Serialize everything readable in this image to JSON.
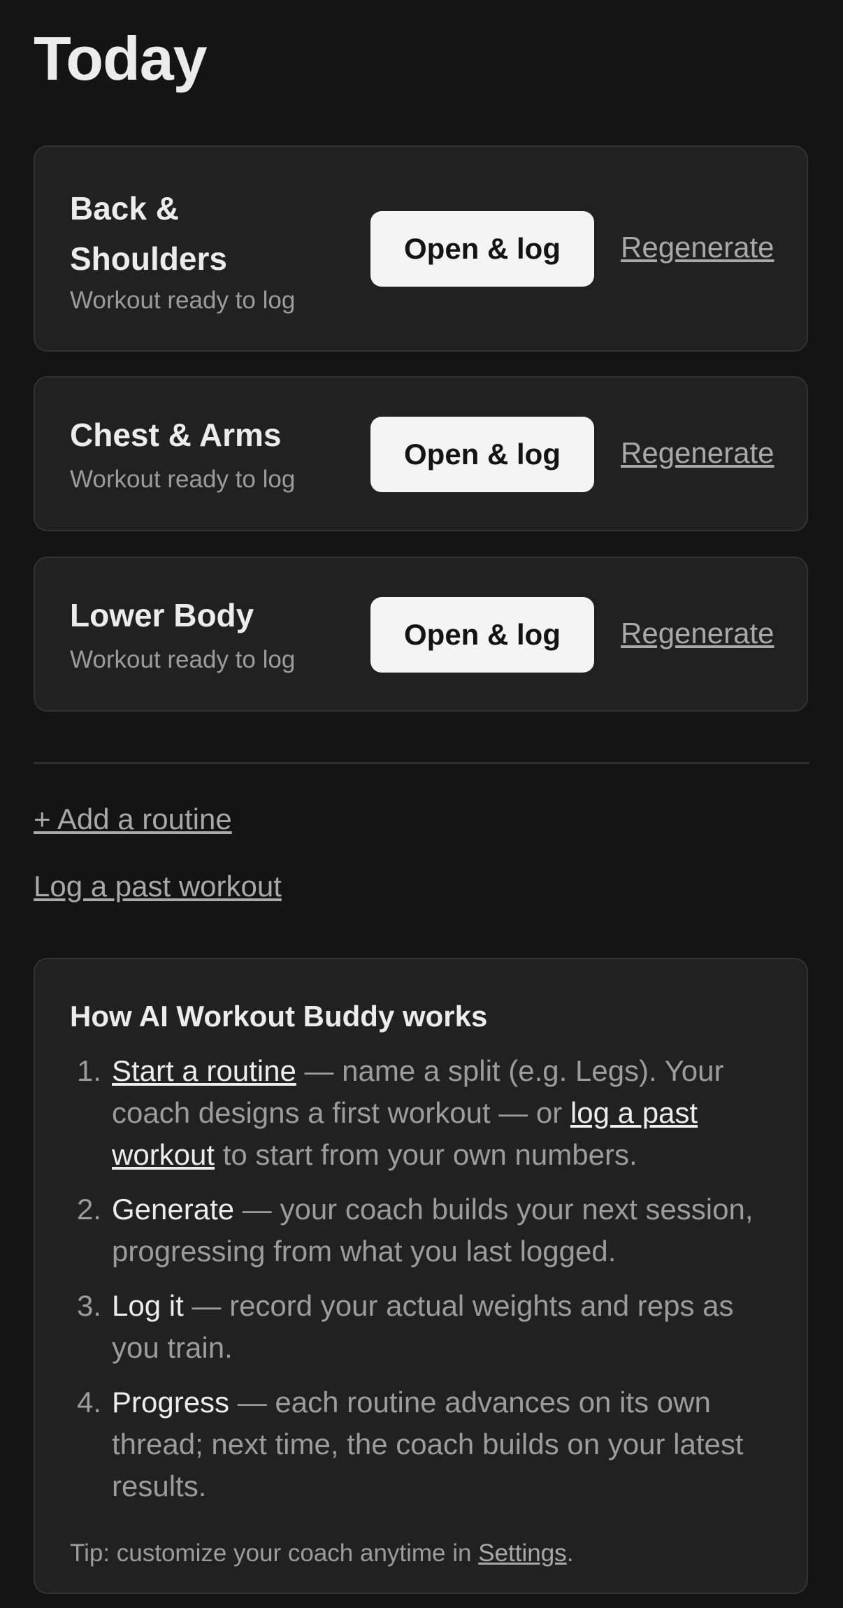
{
  "header": {
    "title": "Today"
  },
  "routines": [
    {
      "name_line1": "Back &",
      "name_line2": "Shoulders",
      "status": "Workout ready to log",
      "open_label": "Open & log",
      "regenerate_label": "Regenerate"
    },
    {
      "name": "Chest & Arms",
      "status": "Workout ready to log",
      "open_label": "Open & log",
      "regenerate_label": "Regenerate"
    },
    {
      "name": "Lower Body",
      "status": "Workout ready to log",
      "open_label": "Open & log",
      "regenerate_label": "Regenerate"
    }
  ],
  "actions": {
    "add_routine": "+ Add a routine",
    "log_past": "Log a past workout"
  },
  "help": {
    "title": "How AI Workout Buddy works",
    "steps": [
      {
        "num": "1.",
        "lead": "Start a routine",
        "text1": " — name a split (e.g. Legs). Your coach designs a first workout — or ",
        "link": "log a past workout",
        "text2": " to start from your own numbers."
      },
      {
        "num": "2.",
        "lead": "Generate",
        "text1": " — your coach builds your next session, progressing from what you last logged."
      },
      {
        "num": "3.",
        "lead": "Log it",
        "text1": " — record your actual weights and reps as you train."
      },
      {
        "num": "4.",
        "lead": "Progress",
        "text1": " — each routine advances on its own thread; next time, the coach builds on your latest results."
      }
    ],
    "tip_prefix": "Tip: customize your coach anytime in ",
    "tip_link": "Settings",
    "tip_suffix": "."
  },
  "colors": {
    "background": "#141414",
    "card": "#212121",
    "button": "#f4f4f4",
    "muted_text": "#9c9c9c"
  }
}
